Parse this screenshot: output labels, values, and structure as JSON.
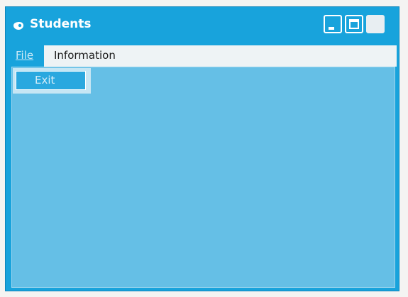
{
  "window": {
    "title": "Students",
    "icon": "app-window-icon",
    "controls": [
      "minimize-icon",
      "maximize-icon",
      "close-icon"
    ]
  },
  "menubar": {
    "items": [
      {
        "label": "File",
        "state": "open"
      },
      {
        "label": "Information"
      }
    ]
  },
  "file_menu": {
    "items": [
      {
        "label": "Exit",
        "state": "highlighted"
      }
    ]
  },
  "colors": {
    "window_frame": "#18a3dc",
    "client_area": "#65bfe6",
    "menubar": "#eef3f5",
    "menu_highlight": "#2aa8df"
  }
}
